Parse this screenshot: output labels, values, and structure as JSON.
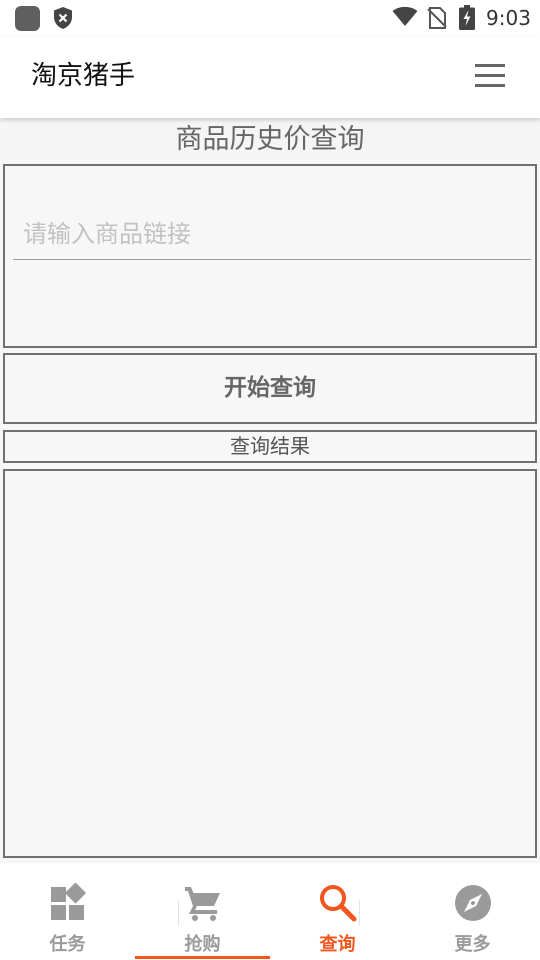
{
  "status_bar": {
    "time": "9:03"
  },
  "app_bar": {
    "title": "淘京猪手"
  },
  "page": {
    "section_title": "商品历史价查询",
    "input_placeholder": "请输入商品链接",
    "input_value": "",
    "query_button_label": "开始查询",
    "results_label": "查询结果"
  },
  "bottom_nav": {
    "active_index": 2,
    "active_color": "#f0561e",
    "inactive_color": "#9a9a9a",
    "items": [
      {
        "label": "任务",
        "icon": "dashboard-icon"
      },
      {
        "label": "抢购",
        "icon": "cart-icon"
      },
      {
        "label": "查询",
        "icon": "search-icon"
      },
      {
        "label": "更多",
        "icon": "compass-icon"
      }
    ]
  }
}
